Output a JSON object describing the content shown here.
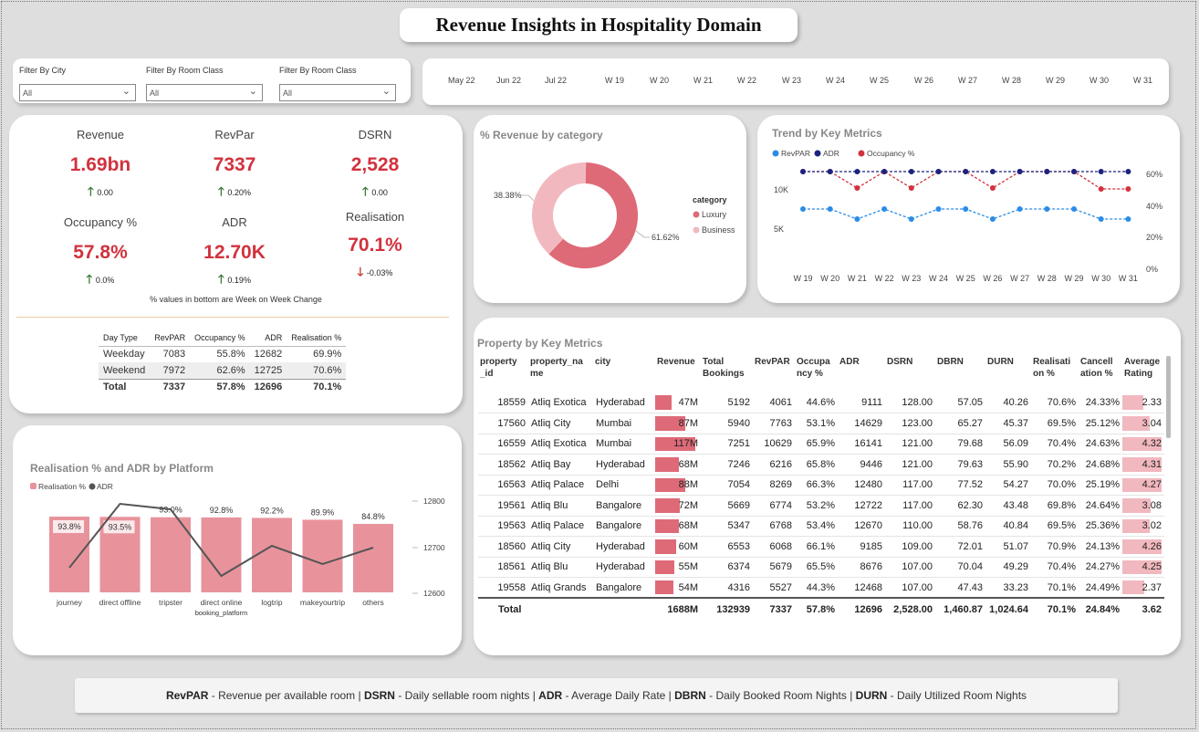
{
  "title": "Revenue Insights in Hospitality Domain",
  "filters": [
    {
      "label": "Filter By City",
      "value": "All"
    },
    {
      "label": "Filter By Room Class",
      "value": "All"
    },
    {
      "label": "Filter By Room Class",
      "value": "All"
    }
  ],
  "slicer": [
    "May 22",
    "Jun 22",
    "Jul 22",
    "W 19",
    "W 20",
    "W 21",
    "W 22",
    "W 23",
    "W 24",
    "W 25",
    "W 26",
    "W 27",
    "W 28",
    "W 29",
    "W 30",
    "W 31"
  ],
  "kpis": [
    {
      "label": "Revenue",
      "value": "1.69bn",
      "delta": "0.00",
      "dir": "up"
    },
    {
      "label": "RevPar",
      "value": "7337",
      "delta": "0.20%",
      "dir": "up"
    },
    {
      "label": "DSRN",
      "value": "2,528",
      "delta": "0.00",
      "dir": "up"
    },
    {
      "label": "Occupancy %",
      "value": "57.8%",
      "delta": "0.0%",
      "dir": "up"
    },
    {
      "label": "ADR",
      "value": "12.70K",
      "delta": "0.19%",
      "dir": "up"
    },
    {
      "label": "Realisation",
      "value": "70.1%",
      "delta": "-0.03%",
      "dir": "down"
    }
  ],
  "kpi_note": "% values in bottom are Week on Week Change",
  "day_type_table": {
    "headers": [
      "Day Type",
      "RevPAR",
      "Occupancy %",
      "ADR",
      "Realisation %"
    ],
    "rows": [
      [
        "Weekday",
        "7083",
        "55.8%",
        "12682",
        "69.9%"
      ],
      [
        "Weekend",
        "7972",
        "62.6%",
        "12725",
        "70.6%"
      ]
    ],
    "total": [
      "Total",
      "7337",
      "57.8%",
      "12696",
      "70.1%"
    ]
  },
  "donut": {
    "title": "% Revenue by category",
    "legend_title": "category",
    "labels": [
      "Luxury",
      "Business"
    ],
    "label_pct": [
      "61.62%",
      "38.38%"
    ],
    "colors": [
      "#de6a78",
      "#f2b8bf"
    ]
  },
  "trend": {
    "title": "Trend by Key Metrics",
    "legend": [
      "RevPAR",
      "ADR",
      "Occupancy %"
    ],
    "colors": [
      "#2a8ce8",
      "#1a237e",
      "#d2323e"
    ],
    "y_left_ticks": [
      "10K",
      "5K"
    ],
    "y_right_ticks": [
      "60%",
      "40%",
      "20%",
      "0%"
    ],
    "x_labels": [
      "W 19",
      "W 20",
      "W 21",
      "W 22",
      "W 23",
      "W 24",
      "W 25",
      "W 26",
      "W 27",
      "W 28",
      "W 29",
      "W 30",
      "W 31"
    ]
  },
  "platform": {
    "title": "Realisation % and ADR by Platform",
    "legend": [
      "Realisation %",
      "ADR"
    ],
    "colors": [
      "#e8939c",
      "#555555"
    ],
    "categories": [
      "journey",
      "direct offline",
      "tripster",
      "direct online",
      "logtrip",
      "makeyourtrip",
      "others"
    ],
    "bar_labels": [
      "93.8%",
      "93.5%",
      "93.0%",
      "92.8%",
      "92.2%",
      "89.9%",
      "84.8%"
    ],
    "x_axis_label": "booking_platform",
    "y_right_ticks": [
      "12800",
      "12700",
      "12600"
    ]
  },
  "property_table": {
    "title": "Property by Key Metrics",
    "headers": [
      "property _id",
      "property_na me",
      "city",
      "Revenue",
      "Total Bookings",
      "RevPAR",
      "Occupa ncy %",
      "ADR",
      "DSRN",
      "DBRN",
      "DURN",
      "Realisati on %",
      "Cancell ation %",
      "Average Rating"
    ],
    "rows": [
      [
        "18559",
        "Atliq Exotica",
        "Hyderabad",
        "47M",
        "5192",
        "4061",
        "44.6%",
        "9111",
        "128.00",
        "57.05",
        "40.26",
        "70.6%",
        "24.33%",
        "2.33"
      ],
      [
        "17560",
        "Atliq City",
        "Mumbai",
        "87M",
        "5940",
        "7763",
        "53.1%",
        "14629",
        "123.00",
        "65.27",
        "45.37",
        "69.5%",
        "25.12%",
        "3.04"
      ],
      [
        "16559",
        "Atliq Exotica",
        "Mumbai",
        "117M",
        "7251",
        "10629",
        "65.9%",
        "16141",
        "121.00",
        "79.68",
        "56.09",
        "70.4%",
        "24.63%",
        "4.32"
      ],
      [
        "18562",
        "Atliq Bay",
        "Hyderabad",
        "68M",
        "7246",
        "6216",
        "65.8%",
        "9446",
        "121.00",
        "79.63",
        "55.90",
        "70.2%",
        "24.68%",
        "4.31"
      ],
      [
        "16563",
        "Atliq Palace",
        "Delhi",
        "88M",
        "7054",
        "8269",
        "66.3%",
        "12480",
        "117.00",
        "77.52",
        "54.27",
        "70.0%",
        "25.19%",
        "4.27"
      ],
      [
        "19561",
        "Atliq Blu",
        "Bangalore",
        "72M",
        "5669",
        "6774",
        "53.2%",
        "12722",
        "117.00",
        "62.30",
        "43.48",
        "69.8%",
        "24.64%",
        "3.08"
      ],
      [
        "19563",
        "Atliq Palace",
        "Bangalore",
        "68M",
        "5347",
        "6768",
        "53.4%",
        "12670",
        "110.00",
        "58.76",
        "40.84",
        "69.5%",
        "25.36%",
        "3.02"
      ],
      [
        "18560",
        "Atliq City",
        "Hyderabad",
        "60M",
        "6553",
        "6068",
        "66.1%",
        "9185",
        "109.00",
        "72.01",
        "51.07",
        "70.9%",
        "24.13%",
        "4.26"
      ],
      [
        "18561",
        "Atliq Blu",
        "Hyderabad",
        "55M",
        "6374",
        "5679",
        "65.5%",
        "8676",
        "107.00",
        "70.04",
        "49.29",
        "70.4%",
        "24.27%",
        "4.25"
      ],
      [
        "19558",
        "Atliq Grands",
        "Bangalore",
        "54M",
        "4316",
        "5527",
        "44.3%",
        "12468",
        "107.00",
        "47.43",
        "33.23",
        "70.1%",
        "24.49%",
        "2.37"
      ]
    ],
    "total": [
      "Total",
      "",
      "",
      "1688M",
      "132939",
      "7337",
      "57.8%",
      "12696",
      "2,528.00",
      "1,460.87",
      "1,024.64",
      "70.1%",
      "24.84%",
      "3.62"
    ]
  },
  "footer": [
    {
      "term": "RevPAR",
      "desc": " - Revenue per available room | "
    },
    {
      "term": "DSRN",
      "desc": " - Daily sellable room nights | "
    },
    {
      "term": "ADR",
      "desc": " - Average Daily Rate | "
    },
    {
      "term": "DBRN",
      "desc": " - Daily Booked Room Nights | "
    },
    {
      "term": "DURN",
      "desc": " - Daily Utilized Room Nights"
    }
  ]
}
